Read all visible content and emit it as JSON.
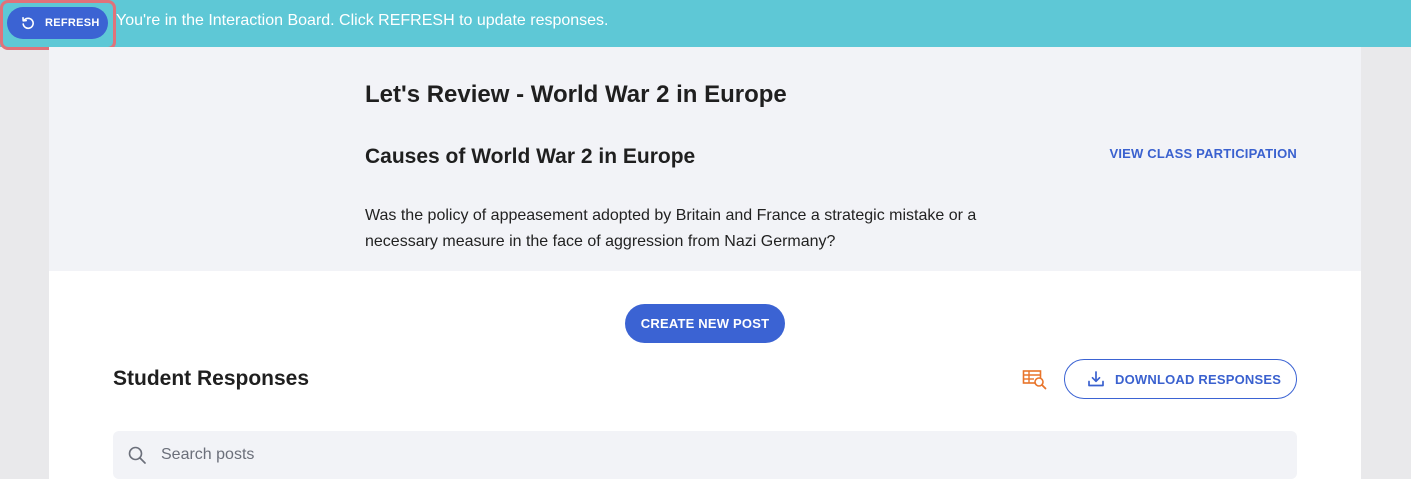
{
  "topbar": {
    "refresh_label": "REFRESH",
    "message": "You're in the Interaction Board. Click REFRESH to update responses.",
    "background_color": "#5ec8d6"
  },
  "board": {
    "title": "Let's Review - World War 2 in Europe",
    "topic_title": "Causes of World War 2 in Europe",
    "view_participation_label": "VIEW CLASS PARTICIPATION",
    "question": "Was the policy of appeasement adopted by Britain and France a strategic mistake or a necessary measure in the face of aggression from Nazi Germany?"
  },
  "actions": {
    "create_post_label": "CREATE NEW POST",
    "accent_color": "#3b63d3"
  },
  "responses": {
    "title": "Student Responses",
    "download_label": "DOWNLOAD RESPONSES",
    "table_search_icon": "table-search-icon",
    "download_icon": "download-icon"
  },
  "search": {
    "placeholder": "Search posts",
    "value": ""
  }
}
